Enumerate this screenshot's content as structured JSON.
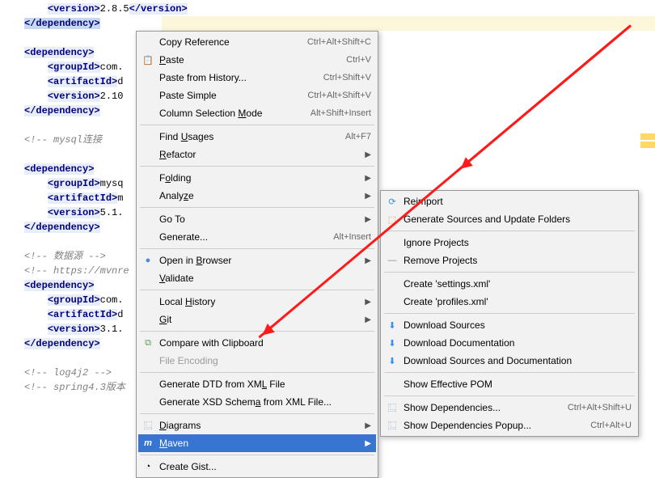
{
  "code": {
    "l1a": "<version>",
    "l1b": "2.8.5",
    "l1c": "</version>",
    "l2": "</dependency>",
    "l3": "<dependency>",
    "l4a": "<groupId>",
    "l4b": "com.",
    "l5a": "<artifactId>",
    "l5b": "d",
    "l6a": "<version>",
    "l6b": "2.10",
    "l7": "</dependency>",
    "l8": "<!-- mysql连接",
    "l9": "<dependency>",
    "l10a": "<groupId>",
    "l10b": "mysq",
    "l11a": "<artifactId>",
    "l11b": "m",
    "l12a": "<version>",
    "l12b": "5.1.",
    "l13": "</dependency>",
    "l14": "<!-- 数据源 -->",
    "l15": "<!-- https://mvnre",
    "l16": "<dependency>",
    "l17a": "<groupId>",
    "l17b": "com.",
    "l18a": "<artifactId>",
    "l18b": "d",
    "l19a": "<version>",
    "l19b": "3.1.",
    "l20": "</dependency>",
    "l21": "<!-- log4j2 -->",
    "l22": "<!-- spring4.3版本"
  },
  "menu1": {
    "copyRef": "Copy Reference",
    "copyRefKey": "Ctrl+Alt+Shift+C",
    "paste": "Paste",
    "pasteKey": "Ctrl+V",
    "pasteHist": "Paste from History...",
    "pasteHistKey": "Ctrl+Shift+V",
    "pasteSimple": "Paste Simple",
    "pasteSimpleKey": "Ctrl+Alt+Shift+V",
    "colSel": "Column Selection Mode",
    "colSelKey": "Alt+Shift+Insert",
    "findUsages": "Find Usages",
    "findUsagesKey": "Alt+F7",
    "refactor": "Refactor",
    "folding": "Folding",
    "analyze": "Analyze",
    "goto": "Go To",
    "generate": "Generate...",
    "generateKey": "Alt+Insert",
    "openBrowser": "Open in Browser",
    "validate": "Validate",
    "localHist": "Local History",
    "git": "Git",
    "compareClip": "Compare with Clipboard",
    "fileEnc": "File Encoding",
    "genDTD": "Generate DTD from XML File",
    "genXSD": "Generate XSD Schema from XML File...",
    "diagrams": "Diagrams",
    "maven": "Maven",
    "createGist": "Create Gist..."
  },
  "menu2": {
    "reimport": "Reimport",
    "genSources": "Generate Sources and Update Folders",
    "ignoreProj": "Ignore Projects",
    "removeProj": "Remove Projects",
    "createSettings": "Create 'settings.xml'",
    "createProfiles": "Create 'profiles.xml'",
    "dlSources": "Download Sources",
    "dlDocs": "Download Documentation",
    "dlBoth": "Download Sources and Documentation",
    "showPom": "Show Effective POM",
    "showDeps": "Show Dependencies...",
    "showDepsKey": "Ctrl+Alt+Shift+U",
    "showDepsPopup": "Show Dependencies Popup...",
    "showDepsPopupKey": "Ctrl+Alt+U"
  }
}
